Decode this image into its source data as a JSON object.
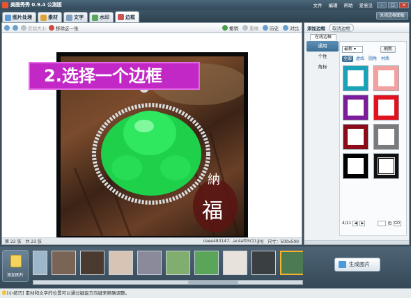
{
  "window": {
    "title": "美图秀秀 0.9.4 公测版",
    "menus": [
      "文件",
      "编辑",
      "帮助",
      "爱意见"
    ],
    "win_buttons": [
      "–",
      "□",
      "×"
    ]
  },
  "tabs": [
    {
      "label": "图片处理",
      "icon": "picture-icon",
      "color": "#5b9bd5"
    },
    {
      "label": "素材",
      "icon": "material-icon",
      "color": "#e0a33a"
    },
    {
      "label": "文字",
      "icon": "text-icon",
      "color": "#7f9fc0"
    },
    {
      "label": "水印",
      "icon": "watermark-icon",
      "color": "#59a55e"
    },
    {
      "label": "边框",
      "icon": "frame-icon",
      "color": "#d05353",
      "active": true
    }
  ],
  "close_border": "关闭边框面板",
  "toolbar": {
    "actual_size": "实际大小",
    "remove_one": "移除这一张",
    "undo": "撤销",
    "redo": "重做",
    "history": "历史",
    "compare": "对比"
  },
  "overlay_text": "2.选择一个边框",
  "status": {
    "page": "第 22 张",
    "total": "共 23 张",
    "file": "ceee483147...ac4af05(1).jpg",
    "size": "尺寸：500x500"
  },
  "panel": {
    "title": "添加边框",
    "cancel": "取消边框",
    "subtab": "在线边框",
    "categories": [
      "通用",
      "个性",
      "角标"
    ],
    "select_value": "最新",
    "refresh": "刷新",
    "filters": [
      "全部",
      "虚线",
      "圆角",
      "材质"
    ],
    "thumb_colors": [
      {
        "outer": "#1aa3b8",
        "inner": "#ffffff"
      },
      {
        "outer": "#f2a0a0",
        "inner": "#ffffff"
      },
      {
        "outer": "#7d1c9a",
        "inner": "#ffffff"
      },
      {
        "outer": "#e0121e",
        "inner": "#ffffff"
      },
      {
        "outer": "#8b0c18",
        "inner": "#ffffff"
      },
      {
        "outer": "#7b7b7b",
        "inner": "#ffffff"
      },
      {
        "outer": "#000000",
        "inner": "#ffffff"
      },
      {
        "outer": "#111111",
        "inner": "#ffffff"
      }
    ],
    "page": "4/11",
    "page_unit": "页",
    "go": "GO"
  },
  "strip": {
    "add_label": "添加图片",
    "thumb_colors": [
      "#9db6c9",
      "#7a6456",
      "#4a3a30",
      "#d8c4b4",
      "#8a8a9a",
      "#7fae6e",
      "#5aa55a",
      "#e7e2dc",
      "#3a3f42",
      "#4c7a52",
      "#c85b3a"
    ],
    "generate": "生成图片"
  },
  "tip": "[小技巧] 素材和文字的位置可以通过键盘方向键来精确调整。"
}
